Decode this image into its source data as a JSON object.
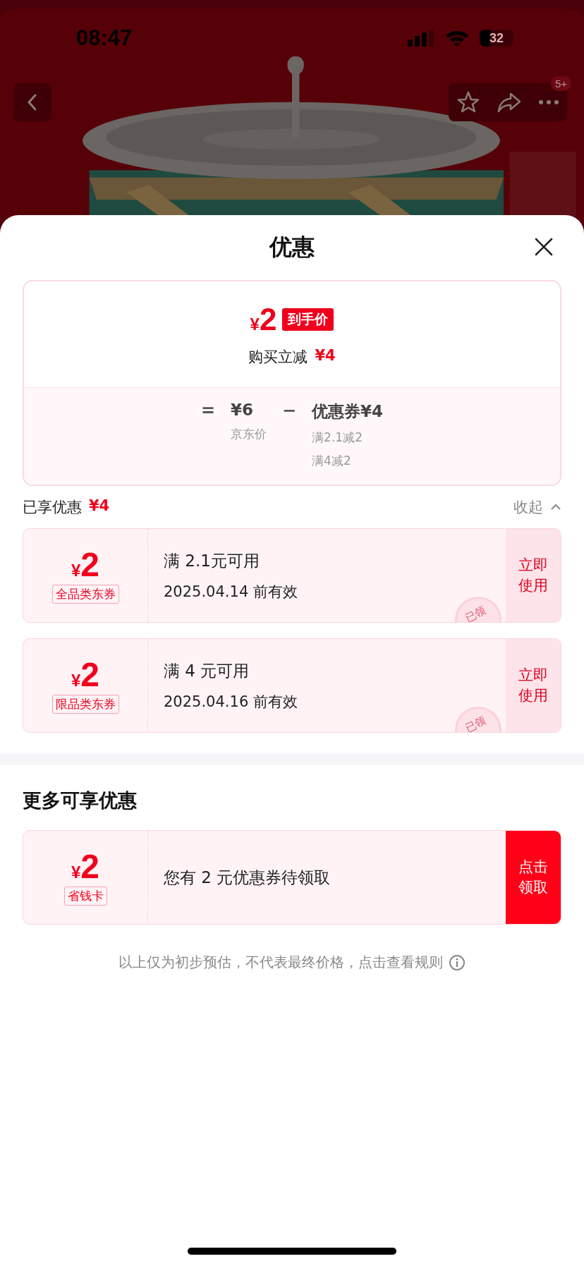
{
  "status_bar": {
    "time": "08:47",
    "battery": "32"
  },
  "nav": {
    "badge": "5+"
  },
  "sheet": {
    "title": "优惠"
  },
  "summary": {
    "final_price": {
      "currency": "¥",
      "amount": "2"
    },
    "price_tag": "到手价",
    "instant_cut": {
      "label": "购买立减",
      "amount": "¥4"
    },
    "formula": {
      "equals": "=",
      "base_price": "¥6",
      "base_label": "京东价",
      "minus": "−",
      "discount": "优惠券¥4",
      "rules": [
        "满2.1减2",
        "满4减2"
      ]
    }
  },
  "enjoyed": {
    "label": "已享优惠",
    "amount": "¥4",
    "toggle": "收起",
    "expanded": true
  },
  "coupons": [
    {
      "kind": "use",
      "currency": "¥",
      "amount": "2",
      "tag": "全品类东券",
      "condition": "满 2.1元可用",
      "validity": "2025.04.14 前有效",
      "stamp": "已领",
      "action": "立即使用"
    },
    {
      "kind": "use",
      "currency": "¥",
      "amount": "2",
      "tag": "限品类东券",
      "condition": "满 4 元可用",
      "validity": "2025.04.16 前有效",
      "stamp": "已领",
      "action": "立即使用"
    }
  ],
  "more": {
    "title": "更多可享优惠",
    "offers": [
      {
        "kind": "claim",
        "currency": "¥",
        "amount": "2",
        "tag": "省钱卡",
        "condition": "您有 2 元优惠券待领取",
        "action": "点击领取"
      }
    ]
  },
  "footnote": "以上仅为初步预估，不代表最终价格，点击查看规则"
}
